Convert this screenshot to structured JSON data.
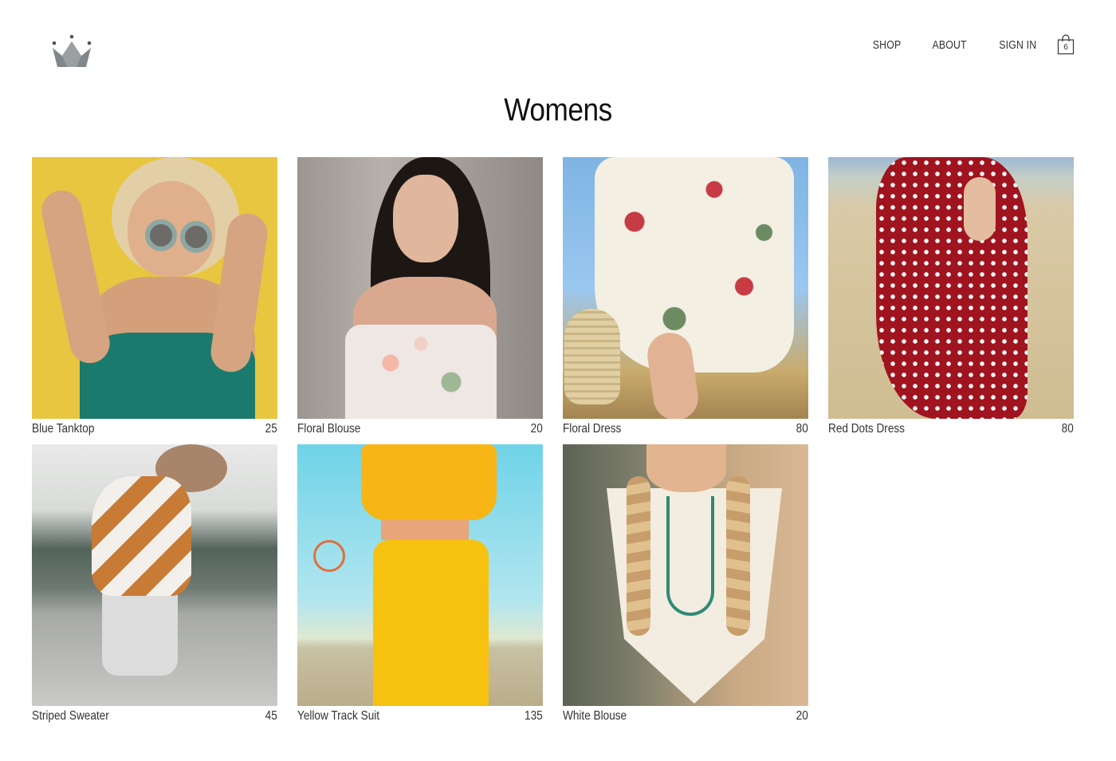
{
  "page": {
    "title": "Womens"
  },
  "header": {
    "logo": "crown-logo",
    "nav": {
      "shop": "SHOP",
      "about": "ABOUT",
      "sign_in": "SIGN IN"
    },
    "cart": {
      "icon": "shopping-bag-icon",
      "count": "6"
    }
  },
  "products": [
    {
      "name": "Blue Tanktop",
      "price": "25"
    },
    {
      "name": "Floral Blouse",
      "price": "20"
    },
    {
      "name": "Floral Dress",
      "price": "80"
    },
    {
      "name": "Red Dots Dress",
      "price": "80"
    },
    {
      "name": "Striped Sweater",
      "price": "45"
    },
    {
      "name": "Yellow Track Suit",
      "price": "135"
    },
    {
      "name": "White Blouse",
      "price": "20"
    }
  ],
  "colors": {
    "logo_gray": "#7d8486",
    "text": "#333333",
    "title": "#111111",
    "background": "#ffffff"
  }
}
